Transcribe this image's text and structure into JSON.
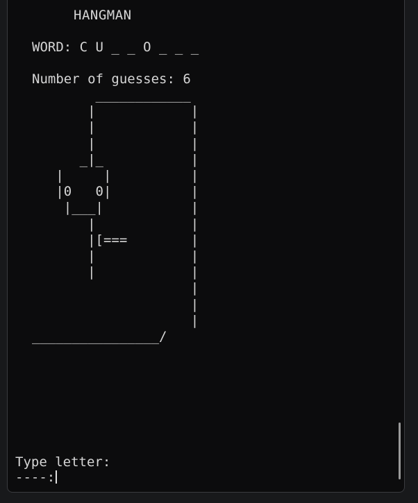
{
  "game": {
    "title": "HANGMAN",
    "word_label": "WORD:",
    "word_display": "C U _ _ O _ _ _",
    "guesses_label": "Number of guesses:",
    "guesses_count": "6"
  },
  "gallows_art": "        ____________\n       |            |\n       |            |\n       |            |\n      _|_           |\n   |     |          |\n   |0   0|          |\n    |___|           |\n       |            |\n       |[===        |\n       |            |\n       |            |\n                    |\n                    |\n                    |\n________________/",
  "prompt": {
    "label": "Type letter:",
    "input_prefix": "----:",
    "input_value": ""
  }
}
